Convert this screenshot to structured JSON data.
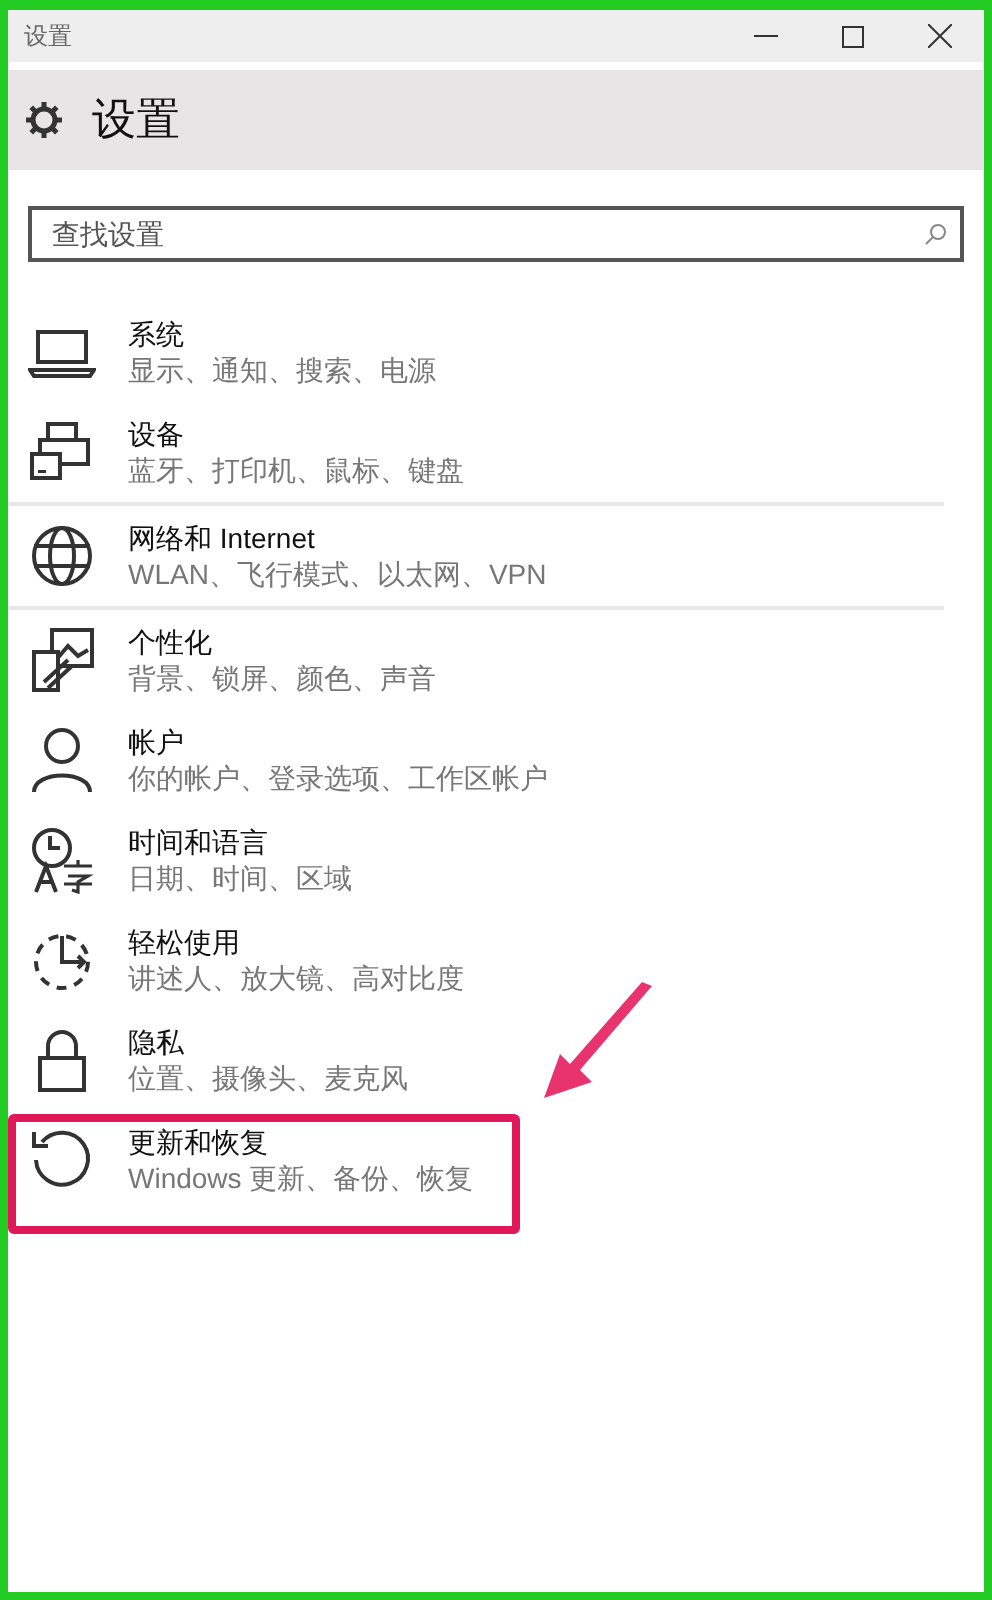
{
  "window": {
    "title": "设置"
  },
  "header": {
    "title": "设置"
  },
  "search": {
    "placeholder": "查找设置"
  },
  "items": [
    {
      "kind": "system",
      "title": "系统",
      "subtitle": "显示、通知、搜索、电源",
      "separator": false,
      "highlighted": false
    },
    {
      "kind": "devices",
      "title": "设备",
      "subtitle": "蓝牙、打印机、鼠标、键盘",
      "separator": true,
      "highlighted": false
    },
    {
      "kind": "network",
      "title": "网络和 Internet",
      "subtitle": "WLAN、飞行模式、以太网、VPN",
      "separator": true,
      "highlighted": false
    },
    {
      "kind": "personalization",
      "title": "个性化",
      "subtitle": "背景、锁屏、颜色、声音",
      "separator": false,
      "highlighted": false
    },
    {
      "kind": "accounts",
      "title": "帐户",
      "subtitle": "你的帐户、登录选项、工作区帐户",
      "separator": false,
      "highlighted": false
    },
    {
      "kind": "time",
      "title": "时间和语言",
      "subtitle": "日期、时间、区域",
      "separator": false,
      "highlighted": false
    },
    {
      "kind": "ease",
      "title": "轻松使用",
      "subtitle": "讲述人、放大镜、高对比度",
      "separator": false,
      "highlighted": false
    },
    {
      "kind": "privacy",
      "title": "隐私",
      "subtitle": "位置、摄像头、麦克风",
      "separator": false,
      "highlighted": false
    },
    {
      "kind": "update",
      "title": "更新和恢复",
      "subtitle": "Windows 更新、备份、恢复",
      "separator": false,
      "highlighted": true
    }
  ],
  "annotation": {
    "kind": "arrow"
  }
}
